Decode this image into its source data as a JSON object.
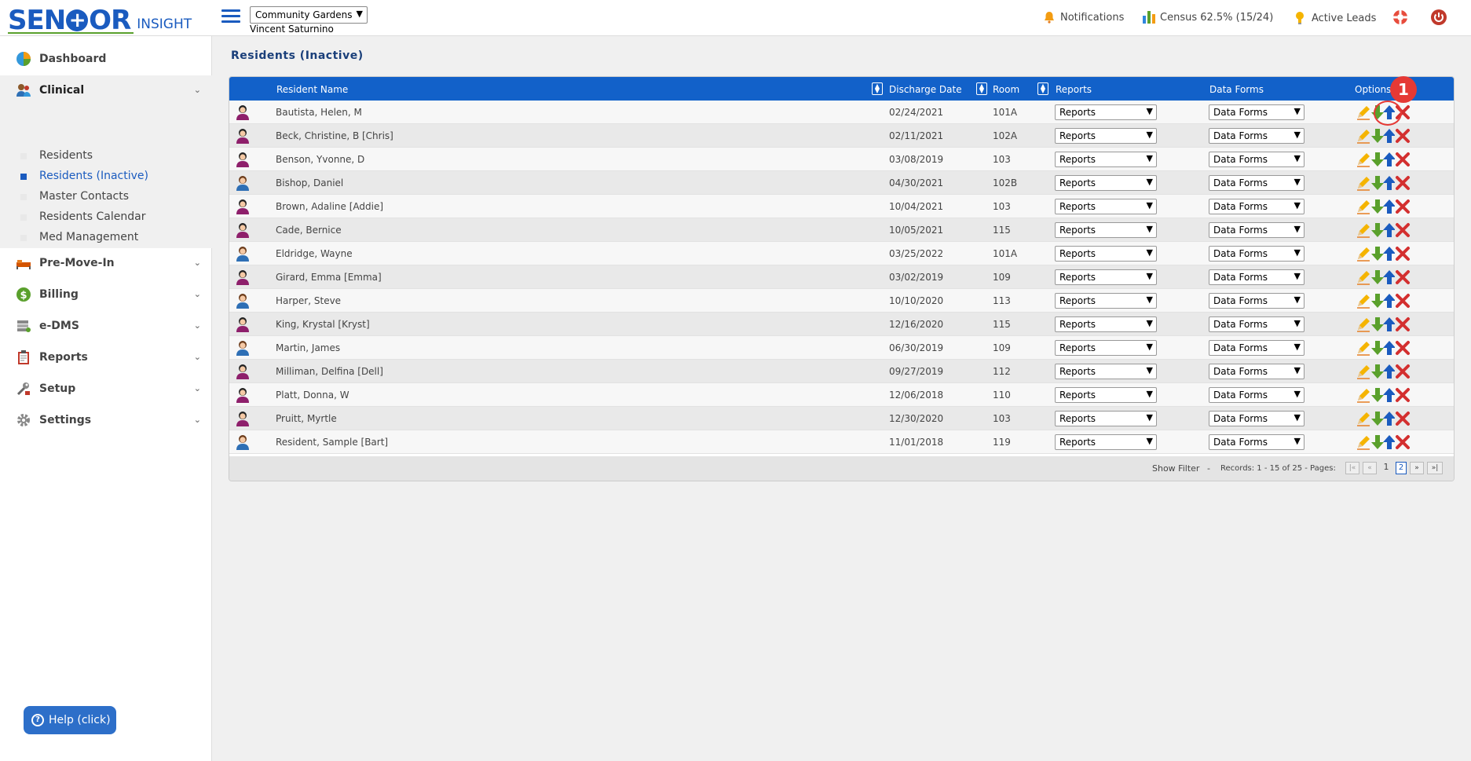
{
  "brand": {
    "name_part1": "SEN",
    "name_part2": "OR",
    "product": "INSIGHT"
  },
  "header": {
    "facility": "Community Gardens",
    "user": "Vincent Saturnino",
    "notifications_label": "Notifications",
    "census_label": "Census 62.5% (15/24)",
    "leads_label": "Active Leads"
  },
  "sidebar": {
    "dashboard": "Dashboard",
    "clinical": "Clinical",
    "clinical_items": [
      "Residents",
      "Residents (Inactive)",
      "Master Contacts",
      "Residents Calendar",
      "Med Management"
    ],
    "pre_move_in": "Pre-Move-In",
    "billing": "Billing",
    "edms": "e-DMS",
    "reports": "Reports",
    "setup": "Setup",
    "settings": "Settings",
    "help": "Help (click)"
  },
  "page": {
    "title": "Residents (Inactive)"
  },
  "grid": {
    "columns": {
      "name": "Resident Name",
      "discharge": "Discharge Date",
      "room": "Room",
      "reports": "Reports",
      "data_forms": "Data Forms",
      "options": "Options"
    },
    "select_reports": "Reports",
    "select_data_forms": "Data Forms",
    "rows": [
      {
        "name": "Bautista, Helen, M",
        "discharge": "02/24/2021",
        "room": "101A",
        "gender": "female"
      },
      {
        "name": "Beck, Christine, B [Chris]",
        "discharge": "02/11/2021",
        "room": "102A",
        "gender": "female"
      },
      {
        "name": "Benson, Yvonne, D",
        "discharge": "03/08/2019",
        "room": "103",
        "gender": "female"
      },
      {
        "name": "Bishop, Daniel",
        "discharge": "04/30/2021",
        "room": "102B",
        "gender": "male"
      },
      {
        "name": "Brown, Adaline [Addie]",
        "discharge": "10/04/2021",
        "room": "103",
        "gender": "female"
      },
      {
        "name": "Cade, Bernice",
        "discharge": "10/05/2021",
        "room": "115",
        "gender": "female"
      },
      {
        "name": "Eldridge, Wayne",
        "discharge": "03/25/2022",
        "room": "101A",
        "gender": "male"
      },
      {
        "name": "Girard, Emma [Emma]",
        "discharge": "03/02/2019",
        "room": "109",
        "gender": "female"
      },
      {
        "name": "Harper, Steve",
        "discharge": "10/10/2020",
        "room": "113",
        "gender": "male"
      },
      {
        "name": "King, Krystal [Kryst]",
        "discharge": "12/16/2020",
        "room": "115",
        "gender": "female"
      },
      {
        "name": "Martin, James",
        "discharge": "06/30/2019",
        "room": "109",
        "gender": "male"
      },
      {
        "name": "Milliman, Delfina [Dell]",
        "discharge": "09/27/2019",
        "room": "112",
        "gender": "female"
      },
      {
        "name": "Platt, Donna, W",
        "discharge": "12/06/2018",
        "room": "110",
        "gender": "female"
      },
      {
        "name": "Pruitt, Myrtle",
        "discharge": "12/30/2020",
        "room": "103",
        "gender": "female"
      },
      {
        "name": "Resident, Sample [Bart]",
        "discharge": "11/01/2018",
        "room": "119",
        "gender": "male"
      }
    ],
    "footer": {
      "show_filter": "Show Filter",
      "dash": "-",
      "records": "Records: 1 - 15 of 25 - Pages:",
      "page1": "1",
      "page2": "2"
    }
  },
  "annotation": {
    "badge": "1"
  },
  "colors": {
    "brand_blue": "#1a5bbf",
    "header_blue": "#1261c9",
    "female_avatar": "#8e1f6b",
    "male_avatar": "#2e6fb5",
    "delete_red": "#d32f2f",
    "arrow_green": "#5aa02c"
  }
}
